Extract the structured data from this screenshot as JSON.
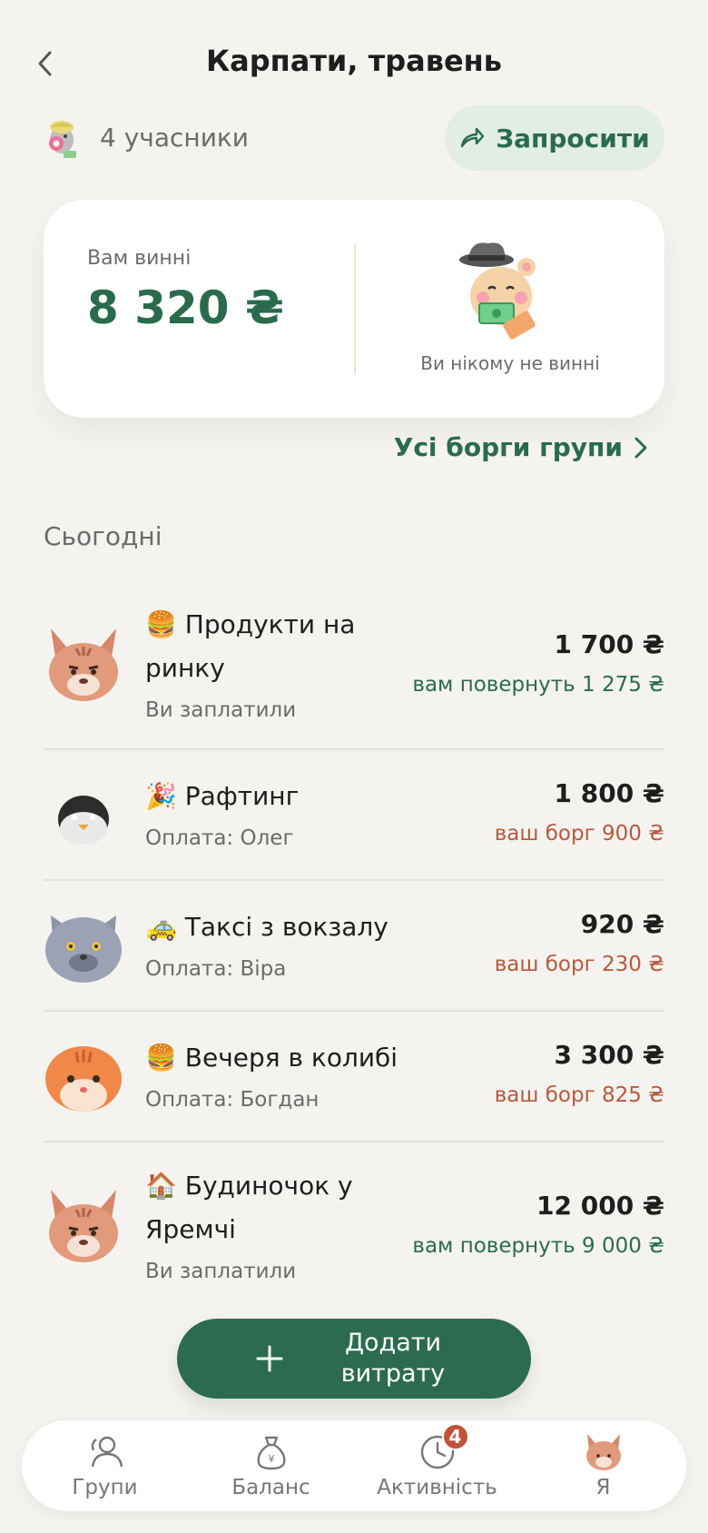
{
  "header": {
    "title": "Карпати, травень"
  },
  "members": {
    "label": "4 учасники"
  },
  "request_button": {
    "label": "Запросити"
  },
  "balance_card": {
    "owed_label": "Вам винні",
    "owed_amount": "8 320 ₴",
    "you_owe_label": "Ви нікому не винні"
  },
  "all_debts": {
    "label": "Усі борги групи"
  },
  "section": {
    "label": "Сьогодні"
  },
  "expenses": [
    {
      "icon": "🍔",
      "name": "Продукти на ринку",
      "sub": "Ви заплатили",
      "amount": "1 700 ₴",
      "share": "вам повернуть 1 275 ₴",
      "type": "positive",
      "avatar": "lynx-cat"
    },
    {
      "icon": "🎉",
      "name": "Рафтинг",
      "sub": "Оплата: Олег",
      "amount": "1 800 ₴",
      "share": "ваш борг 900 ₴",
      "type": "negative",
      "avatar": "penguin"
    },
    {
      "icon": "🚕",
      "name": "Таксі з вокзалу",
      "sub": "Оплата: Віра",
      "amount": "920 ₴",
      "share": "ваш борг 230 ₴",
      "type": "negative",
      "avatar": "gray-cat"
    },
    {
      "icon": "🍔",
      "name": "Вечеря в колибі",
      "sub": "Оплата: Богдан",
      "amount": "3 300 ₴",
      "share": "ваш борг 825 ₴",
      "type": "negative",
      "avatar": "orange-cat"
    },
    {
      "icon": "🏠",
      "name": "Будиночок у Яремчі",
      "sub": "Ви заплатили",
      "amount": "12 000 ₴",
      "share": "вам повернуть 9 000 ₴",
      "type": "positive",
      "avatar": "lynx-cat"
    }
  ],
  "add_button": {
    "label": "Додати витрату"
  },
  "nav": {
    "items": [
      {
        "label": "Групи",
        "icon": "people-icon"
      },
      {
        "label": "Баланс",
        "icon": "money-bag-icon"
      },
      {
        "label": "Активність",
        "icon": "clock-icon",
        "badge": "4"
      },
      {
        "label": "Я",
        "icon": "profile-avatar"
      }
    ]
  },
  "colors": {
    "accent": "#2a6b4e",
    "negative": "#b65a3c",
    "background": "#f4f3ef"
  }
}
